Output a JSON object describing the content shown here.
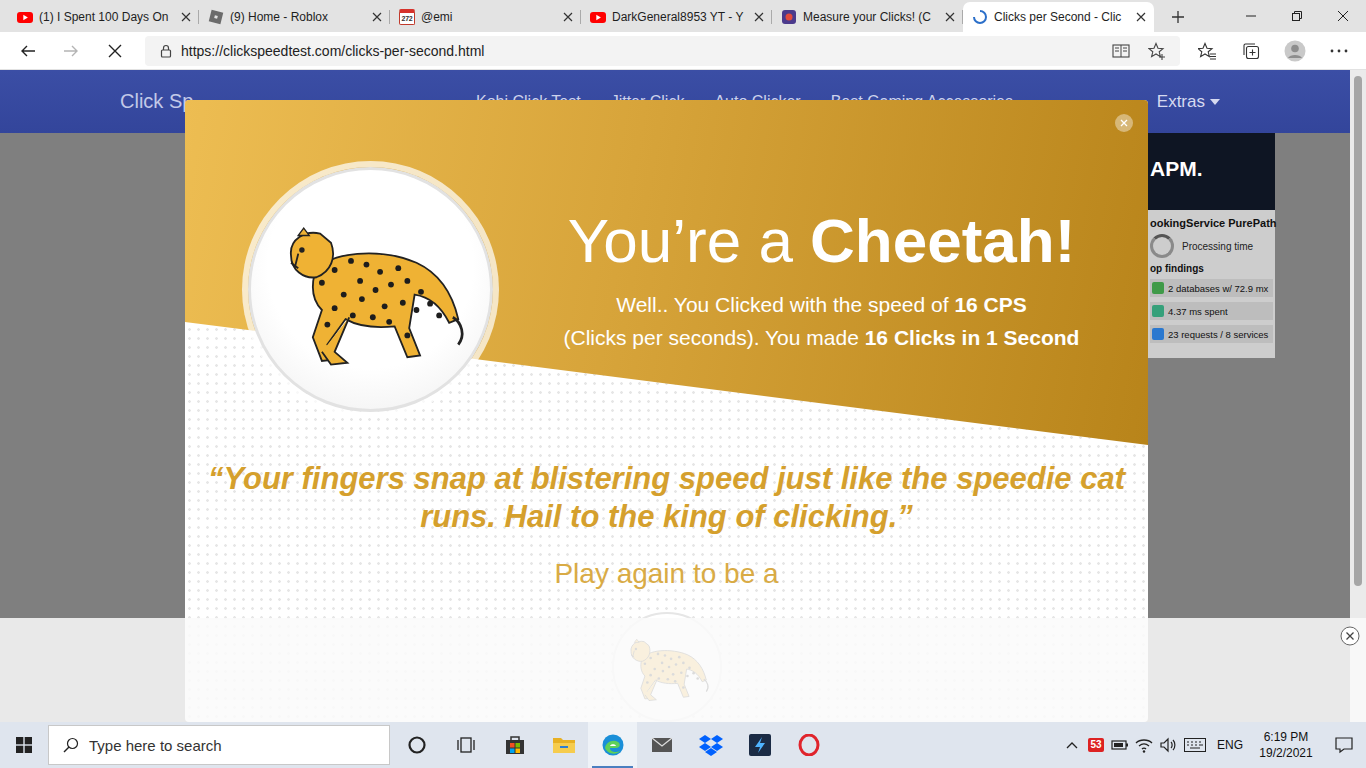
{
  "browser": {
    "tabs": [
      {
        "label": "(1) I Spent 100 Days On",
        "kind": "youtube",
        "selected": false
      },
      {
        "label": "(9) Home - Roblox",
        "kind": "roblox",
        "selected": false
      },
      {
        "label": "@emi",
        "kind": "counter",
        "badge": "272",
        "selected": false
      },
      {
        "label": "DarkGeneral8953 YT - Y",
        "kind": "youtube",
        "selected": false
      },
      {
        "label": "Measure your Clicks! (C",
        "kind": "app",
        "selected": false
      },
      {
        "label": "Clicks per Second - Clic",
        "kind": "loading",
        "selected": true
      }
    ],
    "url": "https://clickspeedtest.com/clicks-per-second.html",
    "forward_disabled": true,
    "loading": true
  },
  "site": {
    "brand": "Click Sp",
    "nav": [
      "Kohi Click Test",
      "Jitter Click",
      "Auto Clicker",
      "Best Gaming Accessories"
    ],
    "menu": "Extras"
  },
  "side_ad": {
    "heading": "APM.",
    "title": "ookingService PurePath",
    "metric": "Processing time",
    "section": "op findings",
    "findings": [
      {
        "text": "2 databases w/ 72.9 mx",
        "color": "#3f9a48"
      },
      {
        "text": "4.37 ms spent",
        "color": "#35a07a"
      },
      {
        "text": "23 requests / 8 services",
        "color": "#2a78cf"
      }
    ]
  },
  "result": {
    "title_prefix": "You’re a ",
    "title_emphasis": "Cheetah!",
    "lines": [
      [
        {
          "text": "Well.. You Clicked with the speed of ",
          "bold": false
        },
        {
          "text": "16 CPS",
          "bold": true
        }
      ],
      [
        {
          "text": "(Clicks per seconds). You made ",
          "bold": false
        },
        {
          "text": "16 Clicks in 1 Second",
          "bold": true
        }
      ]
    ],
    "quote": "“Your fingers snap at blistering speed just like the speedie cat runs. Hail to the king of clicking.”",
    "play_again": "Play again to be a"
  },
  "taskbar": {
    "search_placeholder": "Type here to search",
    "apps": [
      {
        "kind": "cortana",
        "active": false
      },
      {
        "kind": "taskview",
        "active": false
      },
      {
        "kind": "store",
        "active": false
      },
      {
        "kind": "explorer",
        "active": false
      },
      {
        "kind": "edge",
        "active": true
      },
      {
        "kind": "mail",
        "active": false
      },
      {
        "kind": "dropbox",
        "active": false
      },
      {
        "kind": "app",
        "active": false
      },
      {
        "kind": "opera",
        "active": false
      }
    ],
    "security_badge": "53",
    "language": "ENG",
    "time": "6:19 PM",
    "date": "19/2/2021"
  }
}
